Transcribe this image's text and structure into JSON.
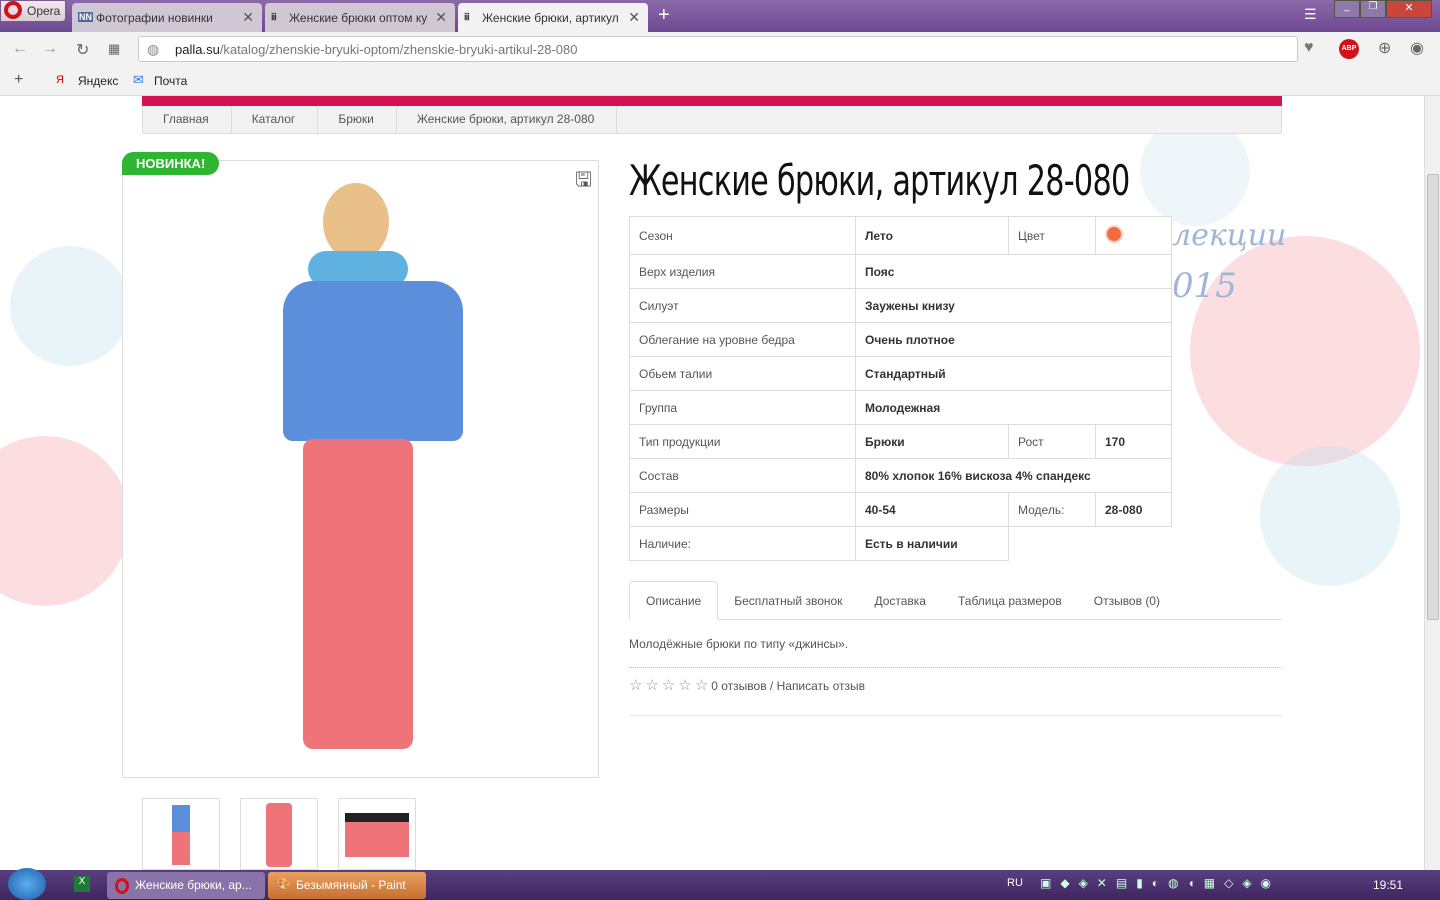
{
  "browser": {
    "app": "Opera",
    "tabs": [
      {
        "label": "Фотографии новинки",
        "icon": "NN"
      },
      {
        "label": "Женские брюки оптом ку"
      },
      {
        "label": "Женские брюки, артикул"
      }
    ],
    "url_domain": "palla.su",
    "url_path": "/katalog/zhenskie-bryuki-optom/zhenskie-bryuki-artikul-28-080",
    "bookmarks": [
      "Яндекс",
      "Почта"
    ],
    "abp": "ABP"
  },
  "breadcrumbs": [
    "Главная",
    "Каталог",
    "Брюки",
    "Женские брюки, артикул 28-080"
  ],
  "badge": "НОВИНКА!",
  "title": "Женские брюки, артикул 28-080",
  "bg_text": [
    "лекции",
    "015"
  ],
  "spec": {
    "season": {
      "label": "Сезон",
      "value": "Лето"
    },
    "color": {
      "label": "Цвет",
      "hex": "#f26b3a"
    },
    "rows": [
      {
        "label": "Верх изделия",
        "value": "Пояс"
      },
      {
        "label": "Силуэт",
        "value": "Заужены книзу"
      },
      {
        "label": "Облегание на уровне бедра",
        "value": "Очень плотное"
      },
      {
        "label": "Обьем талии",
        "value": "Стандартный"
      },
      {
        "label": "Группа",
        "value": "Молодежная"
      }
    ],
    "type": {
      "label": "Тип продукции",
      "value": "Брюки"
    },
    "height": {
      "label": "Рост",
      "value": "170"
    },
    "composition": {
      "label": "Состав",
      "value": "80% хлопок 16% вискоза 4% спандекс"
    },
    "sizes": {
      "label": "Размеры",
      "value": "40-54"
    },
    "model": {
      "label": "Модель:",
      "value": "28-080"
    },
    "availability": {
      "label": "Наличие:",
      "value": "Есть в наличии"
    }
  },
  "tabs": [
    "Описание",
    "Бесплатный звонок",
    "Доставка",
    "Таблица размеров",
    "Отзывов (0)"
  ],
  "description": "Молодёжные брюки по типу «джинсы».",
  "rating": {
    "stars": 0,
    "text": "0 отзывов / Написать отзыв"
  },
  "taskbar": {
    "items": [
      "Женские брюки, ар...",
      "Безымянный - Paint"
    ],
    "lang": "RU",
    "time": "19:51"
  }
}
